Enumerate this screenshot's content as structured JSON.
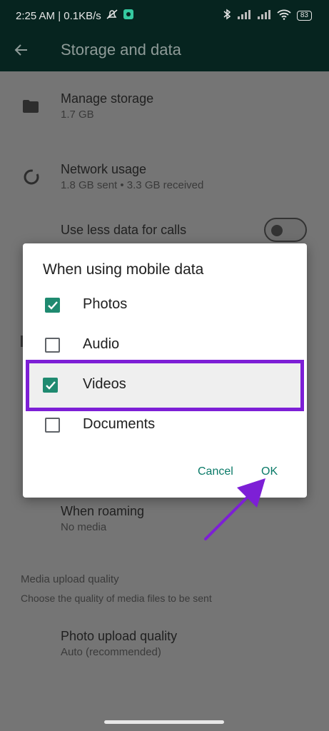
{
  "status_bar": {
    "time_info": "2:25 AM | 0.1KB/s",
    "battery": "83"
  },
  "app_bar": {
    "title": "Storage and data"
  },
  "settings": {
    "manage_storage": {
      "title": "Manage storage",
      "subtitle": "1.7 GB"
    },
    "network_usage": {
      "title": "Network usage",
      "subtitle": "1.8 GB sent • 3.3 GB received"
    },
    "use_less_data": {
      "title": "Use less data for calls"
    },
    "when_roaming": {
      "title": "When roaming",
      "subtitle": "No media"
    },
    "media_upload": {
      "title": "Media upload quality",
      "subtitle": "Choose the quality of media files to be sent"
    },
    "photo_upload": {
      "title": "Photo upload quality",
      "subtitle": "Auto (recommended)"
    }
  },
  "dialog": {
    "title": "When using mobile data",
    "options": [
      {
        "label": "Photos",
        "checked": true
      },
      {
        "label": "Audio",
        "checked": false
      },
      {
        "label": "Videos",
        "checked": true
      },
      {
        "label": "Documents",
        "checked": false
      }
    ],
    "cancel_label": "Cancel",
    "ok_label": "OK"
  },
  "colors": {
    "accent": "#1f8a70",
    "annotation": "#7d1fd6"
  }
}
